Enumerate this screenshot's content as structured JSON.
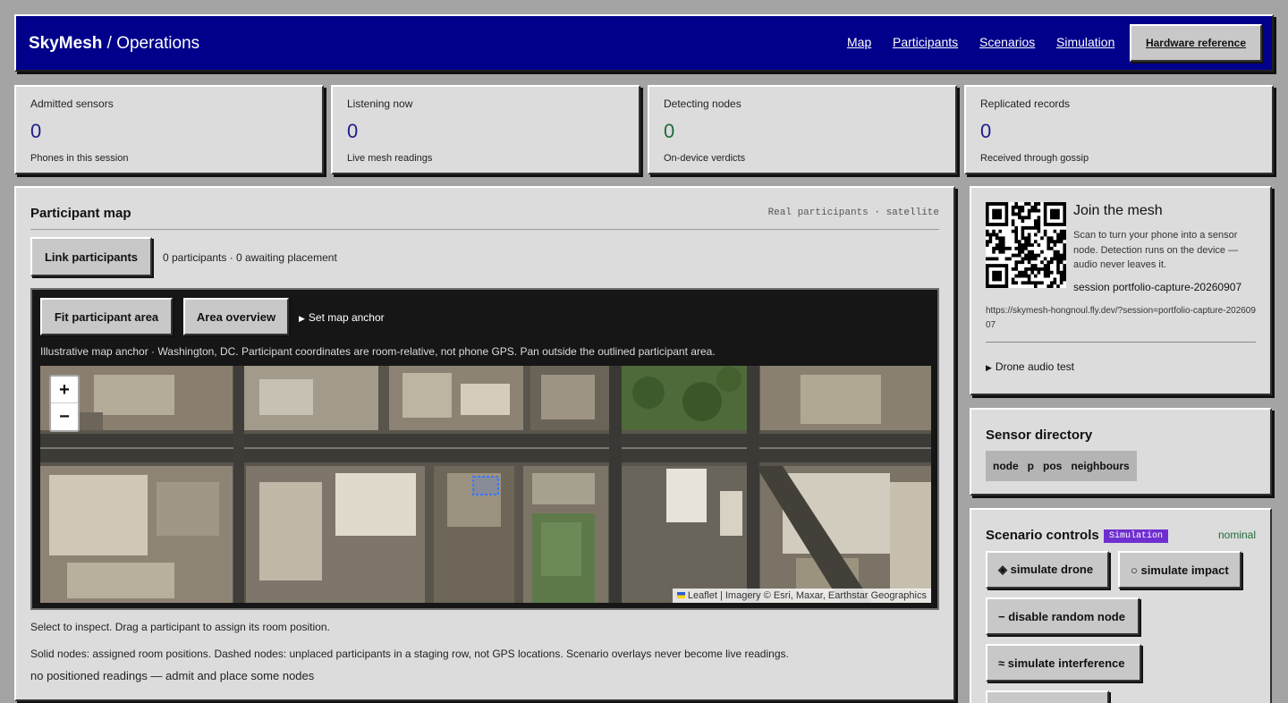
{
  "header": {
    "brand": "SkyMesh",
    "section": " / Operations",
    "nav": [
      "Map",
      "Participants",
      "Scenarios",
      "Simulation"
    ],
    "hardware_reference": "Hardware reference"
  },
  "stats": [
    {
      "label": "Admitted sensors",
      "value": "0",
      "sub": "Phones in this session"
    },
    {
      "label": "Listening now",
      "value": "0",
      "sub": "Live mesh readings"
    },
    {
      "label": "Detecting nodes",
      "value": "0",
      "sub": "On-device verdicts"
    },
    {
      "label": "Replicated records",
      "value": "0",
      "sub": "Received through gossip"
    }
  ],
  "map_panel": {
    "title": "Participant map",
    "tag": "Real participants · satellite",
    "link_button": "Link participants",
    "participants_info": "0 participants · 0 awaiting placement",
    "fit_button": "Fit participant area",
    "area_button": "Area overview",
    "anchor_toggle": "Set map anchor",
    "anchor_note": "Illustrative map anchor · Washington, DC. Participant coordinates are room-relative, not phone GPS. Pan outside the outlined participant area.",
    "zoom_in": "+",
    "zoom_out": "−",
    "attribution_leaflet": "Leaflet",
    "attribution_rest": " | Imagery © Esri, Maxar, Earthstar Geographics",
    "hint_select": "Select to inspect. Drag a participant to assign its room position.",
    "hint_nodes": "Solid nodes: assigned room positions. Dashed nodes: unplaced participants in a staging row, not GPS locations. Scenario overlays never become live readings.",
    "empty_state": "no positioned readings — admit and place some nodes"
  },
  "join": {
    "title": "Join the mesh",
    "description": "Scan to turn your phone into a sensor node. Detection runs on the device — audio never leaves it.",
    "session_label": "session ",
    "session_id": "portfolio-capture-20260907",
    "url": "https://skymesh-hongnoul.fly.dev/?session=portfolio-capture-20260907",
    "drone_test": "Drone audio test"
  },
  "directory": {
    "title": "Sensor directory",
    "columns": [
      "node",
      "p",
      "pos",
      "neighbours"
    ]
  },
  "scenario": {
    "title": "Scenario controls",
    "badge": "Simulation",
    "status": "nominal",
    "buttons": [
      "◈ simulate drone",
      "○ simulate impact",
      "− disable random node",
      "≈ simulate interference"
    ]
  },
  "colors": {
    "header_bg": "#00008b",
    "stat_value": "#1d1d8c",
    "detect_value": "#1f6b3a",
    "badge_bg": "#6f2fd0",
    "participant_outline": "#3a78ff"
  }
}
